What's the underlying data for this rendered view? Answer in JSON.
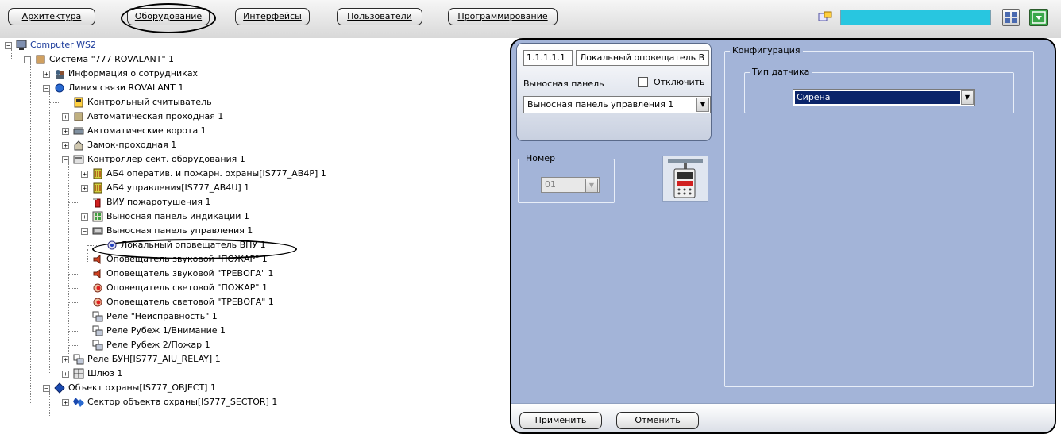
{
  "toolbar": {
    "tabs": [
      {
        "label": "Архитектура"
      },
      {
        "label": "Оборудование"
      },
      {
        "label": "Интерфейсы"
      },
      {
        "label": "Пользователи"
      },
      {
        "label": "Программирование"
      }
    ],
    "active_tab": "Оборудование",
    "search_color": "#28c6e0"
  },
  "tree": {
    "items": [
      {
        "label": "Computer WS2",
        "icon": "computer-icon",
        "expander": "-"
      },
      {
        "label": "Система \"777 ROVALANT\" 1",
        "icon": "system-icon",
        "expander": "-"
      },
      {
        "label": "Информация о сотрудниках",
        "icon": "people-icon",
        "expander": "+"
      },
      {
        "label": "Линия связи ROVALANT 1",
        "icon": "line-icon",
        "expander": "-"
      },
      {
        "label": "Контрольный считыватель",
        "icon": "reader-icon",
        "expander": ""
      },
      {
        "label": "Автоматическая проходная 1",
        "icon": "turnstile-icon",
        "expander": "+"
      },
      {
        "label": "Автоматические ворота 1",
        "icon": "gate-icon",
        "expander": "+"
      },
      {
        "label": "Замок-проходная 1",
        "icon": "lock-icon",
        "expander": "+"
      },
      {
        "label": "Контроллер сект. оборудования 1",
        "icon": "controller-icon",
        "expander": "-"
      },
      {
        "label": "АБ4 оператив. и пожарн. охраны[IS777_AB4P] 1",
        "icon": "module-icon",
        "expander": "+"
      },
      {
        "label": "АБ4 управления[IS777_AB4U] 1",
        "icon": "module-icon",
        "expander": "+"
      },
      {
        "label": "ВИУ пожаротушения 1",
        "icon": "extinguisher-icon",
        "expander": ""
      },
      {
        "label": "Выносная панель индикации 1",
        "icon": "indicator-panel-icon",
        "expander": "+"
      },
      {
        "label": "Выносная панель управления 1",
        "icon": "control-panel-icon",
        "expander": "-"
      },
      {
        "label": "Локальный оповещатель ВПУ 1",
        "icon": "notifier-icon",
        "expander": ""
      },
      {
        "label": "Оповещатель звуковой \"ПОЖАР\" 1",
        "icon": "sound-icon",
        "expander": ""
      },
      {
        "label": "Оповещатель звуковой \"ТРЕВОГА\" 1",
        "icon": "sound-icon",
        "expander": ""
      },
      {
        "label": "Оповещатель световой \"ПОЖАР\" 1",
        "icon": "light-icon",
        "expander": ""
      },
      {
        "label": "Оповещатель световой \"ТРЕВОГА\" 1",
        "icon": "light-icon",
        "expander": ""
      },
      {
        "label": "Реле \"Неисправность\" 1",
        "icon": "relay-icon",
        "expander": ""
      },
      {
        "label": "Реле Рубеж 1/Внимание 1",
        "icon": "relay-icon",
        "expander": ""
      },
      {
        "label": "Реле Рубеж 2/Пожар 1",
        "icon": "relay-icon",
        "expander": ""
      },
      {
        "label": "Реле БУН[IS777_AIU_RELAY] 1",
        "icon": "relay-icon",
        "expander": "+"
      },
      {
        "label": "Шлюз 1",
        "icon": "gateway-icon",
        "expander": "+"
      },
      {
        "label": "Объект охраны[IS777_OBJECT] 1",
        "icon": "object-icon",
        "expander": "-"
      },
      {
        "label": "Сектор объекта охраны[IS777_SECTOR] 1",
        "icon": "sector-icon",
        "expander": "+"
      }
    ],
    "selected": "Локальный оповещатель ВПУ 1"
  },
  "settings": {
    "id": "1.1.1.1.1",
    "name": "Локальный оповещатель В",
    "panel_label": "Выносная панель",
    "disable_label": "Отключить",
    "disable_checked": false,
    "panel_value": "Выносная панель управления 1",
    "number_legend": "Номер",
    "number_value": "01",
    "config_legend": "Конфигурация",
    "sensor_legend": "Тип датчика",
    "sensor_value": "Сирена",
    "apply_label": "Применить",
    "cancel_label": "Отменить"
  },
  "colors": {
    "panel_bg": "#a3b4d8",
    "selection": "#0a246a",
    "green_button": "#3aa84a"
  }
}
